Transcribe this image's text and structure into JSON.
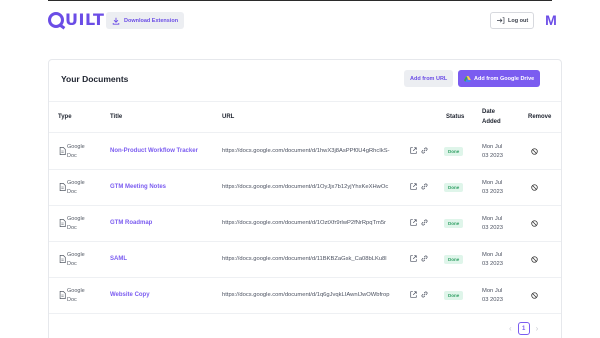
{
  "header": {
    "logo_rest": "UILT",
    "download_label": "Download Extension",
    "logout_label": "Log out",
    "avatar_initial": "M"
  },
  "documents": {
    "title": "Your Documents",
    "add_url_label": "Add from URL",
    "add_drive_label": "Add from Google Drive",
    "columns": {
      "type": "Type",
      "title": "Title",
      "url": "URL",
      "status": "Status",
      "date_added_1": "Date",
      "date_added_2": "Added",
      "remove": "Remove"
    },
    "rows": [
      {
        "type_1": "Google",
        "type_2": "Doc",
        "title": "Non-Product Workflow Tracker",
        "url": "https://docs.google.com/document/d/1hwX3j8AsPPf0U4gRhcIkS-",
        "status": "Done",
        "date_1": "Mon Jul",
        "date_2": "03 2023"
      },
      {
        "type_1": "Google",
        "type_2": "Doc",
        "title": "GTM Meeting Notes",
        "url": "https://docs.google.com/document/d/1OyJjx7b12yjYhxKeXHwOc",
        "status": "Done",
        "date_1": "Mon Jul",
        "date_2": "03 2023"
      },
      {
        "type_1": "Google",
        "type_2": "Doc",
        "title": "GTM Roadmap",
        "url": "https://docs.google.com/document/d/1OztXfr9rlwP2fNrRpqTm5r",
        "status": "Done",
        "date_1": "Mon Jul",
        "date_2": "03 2023"
      },
      {
        "type_1": "Google",
        "type_2": "Doc",
        "title": "SAML",
        "url": "https://docs.google.com/document/d/11BKBZaGsk_Ca08bLKu8l",
        "status": "Done",
        "date_1": "Mon Jul",
        "date_2": "03 2023"
      },
      {
        "type_1": "Google",
        "type_2": "Doc",
        "title": "Website Copy",
        "url": "https://docs.google.com/document/d/1q6gJvqkLIAwnIJwOWbfrop",
        "status": "Done",
        "date_1": "Mon Jul",
        "date_2": "03 2023"
      }
    ]
  },
  "pagination": {
    "prev": "‹",
    "current_page": "1",
    "next": "›"
  },
  "colors": {
    "brand": "#6b4de6",
    "accent": "#7b5cf0",
    "status_done_bg": "#dff5ea",
    "status_done_text": "#2f9e63"
  },
  "icons": {
    "download": "download-icon",
    "logout": "logout-icon",
    "drive": "google-drive-icon",
    "doc": "document-icon",
    "external": "external-link-icon",
    "link": "link-icon",
    "remove": "remove-icon"
  }
}
